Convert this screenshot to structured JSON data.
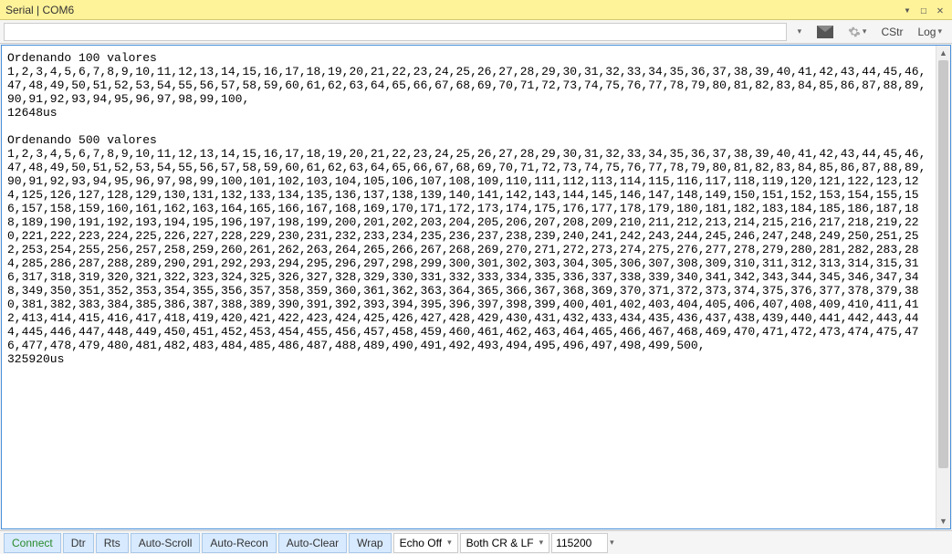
{
  "window": {
    "title": "Serial | COM6"
  },
  "toolbar": {
    "input_value": "",
    "cstr_label": "CStr",
    "log_label": "Log"
  },
  "terminal": {
    "text": "Ordenando 100 valores\n1,2,3,4,5,6,7,8,9,10,11,12,13,14,15,16,17,18,19,20,21,22,23,24,25,26,27,28,29,30,31,32,33,34,35,36,37,38,39,40,41,42,43,44,45,46,47,48,49,50,51,52,53,54,55,56,57,58,59,60,61,62,63,64,65,66,67,68,69,70,71,72,73,74,75,76,77,78,79,80,81,82,83,84,85,86,87,88,89,90,91,92,93,94,95,96,97,98,99,100,\n12648us\n\nOrdenando 500 valores\n1,2,3,4,5,6,7,8,9,10,11,12,13,14,15,16,17,18,19,20,21,22,23,24,25,26,27,28,29,30,31,32,33,34,35,36,37,38,39,40,41,42,43,44,45,46,47,48,49,50,51,52,53,54,55,56,57,58,59,60,61,62,63,64,65,66,67,68,69,70,71,72,73,74,75,76,77,78,79,80,81,82,83,84,85,86,87,88,89,90,91,92,93,94,95,96,97,98,99,100,101,102,103,104,105,106,107,108,109,110,111,112,113,114,115,116,117,118,119,120,121,122,123,124,125,126,127,128,129,130,131,132,133,134,135,136,137,138,139,140,141,142,143,144,145,146,147,148,149,150,151,152,153,154,155,156,157,158,159,160,161,162,163,164,165,166,167,168,169,170,171,172,173,174,175,176,177,178,179,180,181,182,183,184,185,186,187,188,189,190,191,192,193,194,195,196,197,198,199,200,201,202,203,204,205,206,207,208,209,210,211,212,213,214,215,216,217,218,219,220,221,222,223,224,225,226,227,228,229,230,231,232,233,234,235,236,237,238,239,240,241,242,243,244,245,246,247,248,249,250,251,252,253,254,255,256,257,258,259,260,261,262,263,264,265,266,267,268,269,270,271,272,273,274,275,276,277,278,279,280,281,282,283,284,285,286,287,288,289,290,291,292,293,294,295,296,297,298,299,300,301,302,303,304,305,306,307,308,309,310,311,312,313,314,315,316,317,318,319,320,321,322,323,324,325,326,327,328,329,330,331,332,333,334,335,336,337,338,339,340,341,342,343,344,345,346,347,348,349,350,351,352,353,354,355,356,357,358,359,360,361,362,363,364,365,366,367,368,369,370,371,372,373,374,375,376,377,378,379,380,381,382,383,384,385,386,387,388,389,390,391,392,393,394,395,396,397,398,399,400,401,402,403,404,405,406,407,408,409,410,411,412,413,414,415,416,417,418,419,420,421,422,423,424,425,426,427,428,429,430,431,432,433,434,435,436,437,438,439,440,441,442,443,444,445,446,447,448,449,450,451,452,453,454,455,456,457,458,459,460,461,462,463,464,465,466,467,468,469,470,471,472,473,474,475,476,477,478,479,480,481,482,483,484,485,486,487,488,489,490,491,492,493,494,495,496,497,498,499,500,\n325920us"
  },
  "statusbar": {
    "connect_label": "Connect",
    "dtr_label": "Dtr",
    "rts_label": "Rts",
    "autoscroll_label": "Auto-Scroll",
    "autorecon_label": "Auto-Recon",
    "autoclear_label": "Auto-Clear",
    "wrap_label": "Wrap",
    "echo_label": "Echo Off",
    "lineend_label": "Both CR & LF",
    "baud_value": "115200"
  }
}
